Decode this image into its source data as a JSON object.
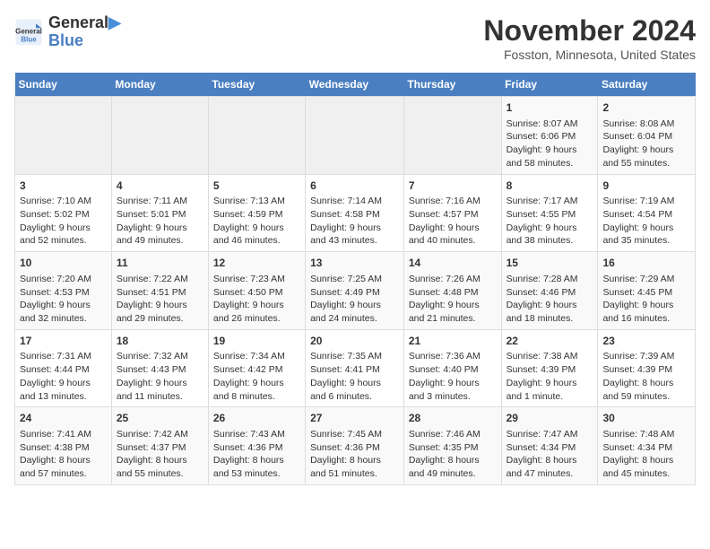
{
  "header": {
    "logo_line1": "General",
    "logo_line2": "Blue",
    "month": "November 2024",
    "location": "Fosston, Minnesota, United States"
  },
  "days_of_week": [
    "Sunday",
    "Monday",
    "Tuesday",
    "Wednesday",
    "Thursday",
    "Friday",
    "Saturday"
  ],
  "weeks": [
    [
      {
        "day": "",
        "info": ""
      },
      {
        "day": "",
        "info": ""
      },
      {
        "day": "",
        "info": ""
      },
      {
        "day": "",
        "info": ""
      },
      {
        "day": "",
        "info": ""
      },
      {
        "day": "1",
        "info": "Sunrise: 8:07 AM\nSunset: 6:06 PM\nDaylight: 9 hours and 58 minutes."
      },
      {
        "day": "2",
        "info": "Sunrise: 8:08 AM\nSunset: 6:04 PM\nDaylight: 9 hours and 55 minutes."
      }
    ],
    [
      {
        "day": "3",
        "info": "Sunrise: 7:10 AM\nSunset: 5:02 PM\nDaylight: 9 hours and 52 minutes."
      },
      {
        "day": "4",
        "info": "Sunrise: 7:11 AM\nSunset: 5:01 PM\nDaylight: 9 hours and 49 minutes."
      },
      {
        "day": "5",
        "info": "Sunrise: 7:13 AM\nSunset: 4:59 PM\nDaylight: 9 hours and 46 minutes."
      },
      {
        "day": "6",
        "info": "Sunrise: 7:14 AM\nSunset: 4:58 PM\nDaylight: 9 hours and 43 minutes."
      },
      {
        "day": "7",
        "info": "Sunrise: 7:16 AM\nSunset: 4:57 PM\nDaylight: 9 hours and 40 minutes."
      },
      {
        "day": "8",
        "info": "Sunrise: 7:17 AM\nSunset: 4:55 PM\nDaylight: 9 hours and 38 minutes."
      },
      {
        "day": "9",
        "info": "Sunrise: 7:19 AM\nSunset: 4:54 PM\nDaylight: 9 hours and 35 minutes."
      }
    ],
    [
      {
        "day": "10",
        "info": "Sunrise: 7:20 AM\nSunset: 4:53 PM\nDaylight: 9 hours and 32 minutes."
      },
      {
        "day": "11",
        "info": "Sunrise: 7:22 AM\nSunset: 4:51 PM\nDaylight: 9 hours and 29 minutes."
      },
      {
        "day": "12",
        "info": "Sunrise: 7:23 AM\nSunset: 4:50 PM\nDaylight: 9 hours and 26 minutes."
      },
      {
        "day": "13",
        "info": "Sunrise: 7:25 AM\nSunset: 4:49 PM\nDaylight: 9 hours and 24 minutes."
      },
      {
        "day": "14",
        "info": "Sunrise: 7:26 AM\nSunset: 4:48 PM\nDaylight: 9 hours and 21 minutes."
      },
      {
        "day": "15",
        "info": "Sunrise: 7:28 AM\nSunset: 4:46 PM\nDaylight: 9 hours and 18 minutes."
      },
      {
        "day": "16",
        "info": "Sunrise: 7:29 AM\nSunset: 4:45 PM\nDaylight: 9 hours and 16 minutes."
      }
    ],
    [
      {
        "day": "17",
        "info": "Sunrise: 7:31 AM\nSunset: 4:44 PM\nDaylight: 9 hours and 13 minutes."
      },
      {
        "day": "18",
        "info": "Sunrise: 7:32 AM\nSunset: 4:43 PM\nDaylight: 9 hours and 11 minutes."
      },
      {
        "day": "19",
        "info": "Sunrise: 7:34 AM\nSunset: 4:42 PM\nDaylight: 9 hours and 8 minutes."
      },
      {
        "day": "20",
        "info": "Sunrise: 7:35 AM\nSunset: 4:41 PM\nDaylight: 9 hours and 6 minutes."
      },
      {
        "day": "21",
        "info": "Sunrise: 7:36 AM\nSunset: 4:40 PM\nDaylight: 9 hours and 3 minutes."
      },
      {
        "day": "22",
        "info": "Sunrise: 7:38 AM\nSunset: 4:39 PM\nDaylight: 9 hours and 1 minute."
      },
      {
        "day": "23",
        "info": "Sunrise: 7:39 AM\nSunset: 4:39 PM\nDaylight: 8 hours and 59 minutes."
      }
    ],
    [
      {
        "day": "24",
        "info": "Sunrise: 7:41 AM\nSunset: 4:38 PM\nDaylight: 8 hours and 57 minutes."
      },
      {
        "day": "25",
        "info": "Sunrise: 7:42 AM\nSunset: 4:37 PM\nDaylight: 8 hours and 55 minutes."
      },
      {
        "day": "26",
        "info": "Sunrise: 7:43 AM\nSunset: 4:36 PM\nDaylight: 8 hours and 53 minutes."
      },
      {
        "day": "27",
        "info": "Sunrise: 7:45 AM\nSunset: 4:36 PM\nDaylight: 8 hours and 51 minutes."
      },
      {
        "day": "28",
        "info": "Sunrise: 7:46 AM\nSunset: 4:35 PM\nDaylight: 8 hours and 49 minutes."
      },
      {
        "day": "29",
        "info": "Sunrise: 7:47 AM\nSunset: 4:34 PM\nDaylight: 8 hours and 47 minutes."
      },
      {
        "day": "30",
        "info": "Sunrise: 7:48 AM\nSunset: 4:34 PM\nDaylight: 8 hours and 45 minutes."
      }
    ]
  ]
}
